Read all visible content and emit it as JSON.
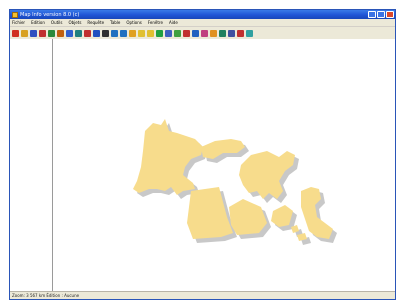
{
  "window": {
    "title": "Map Info version 8.0 (c)"
  },
  "menubar": {
    "items": [
      "Fichier",
      "Edition",
      "Outils",
      "Objets",
      "Requête",
      "Table",
      "Options",
      "Fenêtre",
      "Aide"
    ]
  },
  "toolbar": {
    "buttons": [
      {
        "icon": "new-icon",
        "color": "#d03020"
      },
      {
        "icon": "open-icon",
        "color": "#d8a020"
      },
      {
        "icon": "save-icon",
        "color": "#3050c0"
      },
      {
        "icon": "table-icon",
        "color": "#c03030"
      },
      {
        "icon": "map-icon",
        "color": "#2a8a3a"
      },
      {
        "icon": "pencil-icon",
        "color": "#c06010"
      },
      {
        "icon": "select-icon",
        "color": "#3060d0"
      },
      {
        "icon": "grid-icon",
        "color": "#208080"
      },
      {
        "icon": "layer-icon",
        "color": "#c03030"
      },
      {
        "icon": "info-icon",
        "color": "#2050c0"
      },
      {
        "icon": "search-icon",
        "color": "#303030"
      },
      {
        "icon": "zoom-in-icon",
        "color": "#2070c0"
      },
      {
        "icon": "zoom-out-icon",
        "color": "#2070c0"
      },
      {
        "icon": "pan-icon",
        "color": "#e0a020"
      },
      {
        "icon": "label-icon",
        "color": "#e0c030"
      },
      {
        "icon": "ruler-icon",
        "color": "#e0c030"
      },
      {
        "icon": "refresh-icon",
        "color": "#20a040"
      },
      {
        "icon": "region-icon",
        "color": "#4060c0"
      },
      {
        "icon": "polyline-icon",
        "color": "#40a040"
      },
      {
        "icon": "text-icon",
        "color": "#c03030"
      },
      {
        "icon": "symbol-icon",
        "color": "#2060c0"
      },
      {
        "icon": "chart-icon",
        "color": "#c04080"
      },
      {
        "icon": "legend-icon",
        "color": "#e09020"
      },
      {
        "icon": "layout-icon",
        "color": "#208060"
      },
      {
        "icon": "print-icon",
        "color": "#4050a0"
      },
      {
        "icon": "help-icon",
        "color": "#c03030"
      },
      {
        "icon": "style-icon",
        "color": "#30a0a0"
      }
    ]
  },
  "map": {
    "shape_color": "#f7dc8c",
    "shadow_color": "#c8c8c8"
  },
  "statusbar": {
    "left": "Zoom: 3 567 km  Édition : Aucune",
    "right": ""
  }
}
